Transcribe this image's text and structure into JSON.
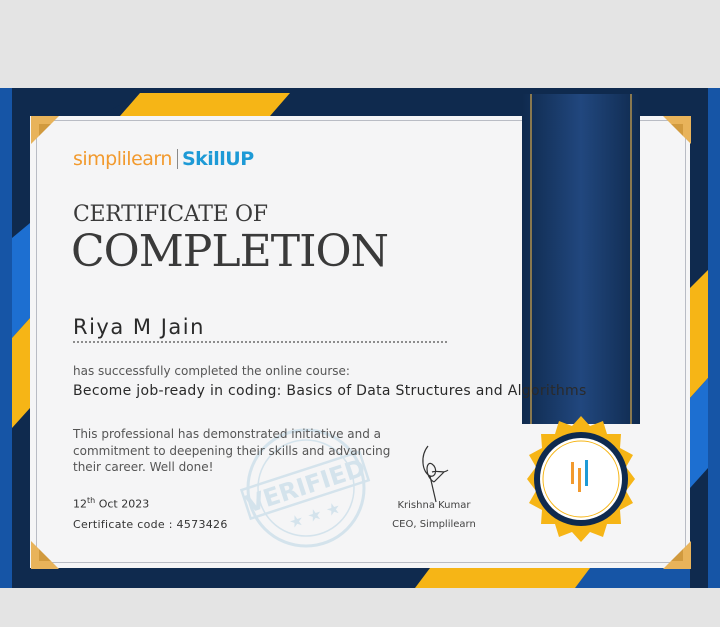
{
  "brand": {
    "simplilearn": "simplilearn",
    "skillup": "SkillUP",
    "badge_glyph": "lil"
  },
  "certificate": {
    "title_small": "CERTIFICATE OF",
    "title_big": "COMPLETION",
    "recipient": "Riya M Jain",
    "completed_text": "has successfully completed the online course:",
    "course": "Become job-ready in coding: Basics of Data Structures and Algorithms",
    "description": "This professional has demonstrated initiative and a commitment to deepening their skills and advancing their career. Well done!",
    "date_day": "12",
    "date_suffix": "th",
    "date_rest": "Oct 2023",
    "code_label": "Certificate code : 4573426",
    "stamp_text": "VERIFIED",
    "signer_name": "Krishna Kumar",
    "signer_title": "CEO, Simplilearn"
  },
  "colors": {
    "navy": "#0f2a4e",
    "blue": "#1655a6",
    "gold": "#f6b516",
    "paper": "#f5f5f6",
    "stamp": "#d4e3ec"
  },
  "icons": [
    "corner-ornament-icon",
    "verified-stamp-icon",
    "signature-icon",
    "ribbon-icon",
    "seal-icon"
  ]
}
